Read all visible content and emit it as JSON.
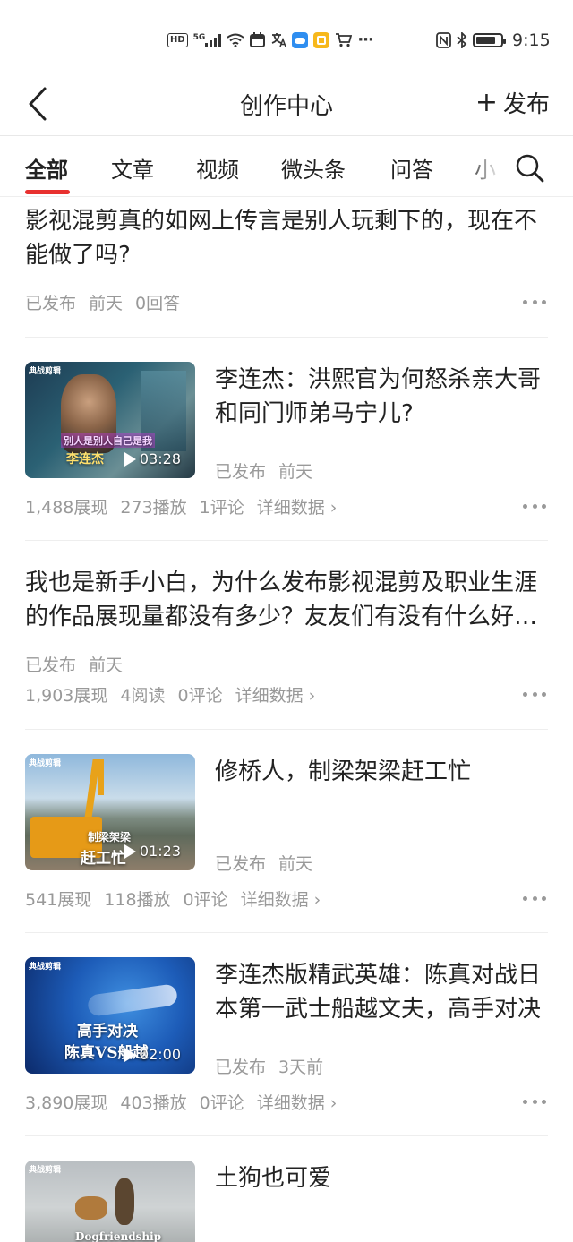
{
  "status_bar": {
    "time": "9:15",
    "left_icons": [
      "hd-icon",
      "5g-signal-icon",
      "wifi-icon",
      "calendar-icon",
      "translate-icon",
      "weather-app-icon",
      "notes-app-icon",
      "cart-icon",
      "more-notifications-icon"
    ],
    "right_icons": [
      "nfc-icon",
      "bluetooth-icon",
      "battery-icon"
    ],
    "hd_label": "HD",
    "net_label": "5G",
    "ellipsis": "···"
  },
  "header": {
    "title": "创作中心",
    "publish_label": "发布",
    "publish_plus": "+"
  },
  "tabs": [
    {
      "label": "全部",
      "active": true
    },
    {
      "label": "文章"
    },
    {
      "label": "视频"
    },
    {
      "label": "微头条"
    },
    {
      "label": "问答"
    },
    {
      "label": "小"
    }
  ],
  "colors": {
    "accent": "#e8312f",
    "meta_text": "#999999",
    "title_text": "#222222",
    "divider": "#eeeeee"
  },
  "feed": {
    "items": [
      {
        "type": "question",
        "title": "影视混剪真的如网上传言是别人玩剩下的，现在不能做了吗?",
        "meta": [
          "已发布",
          "前天",
          "0回答"
        ]
      },
      {
        "type": "video",
        "title": "李连杰：洪熙官为何怒杀亲大哥和同门师弟马宁儿?",
        "status": "已发布",
        "time": "前天",
        "duration": "03:28",
        "thumb_brand": "典战剪辑",
        "thumb_caption": "别人是别人自己是我",
        "thumb_subtitle": "李连杰",
        "stats": [
          "1,488展现",
          "273播放",
          "1评论"
        ],
        "detail_link": "详细数据 ›"
      },
      {
        "type": "article",
        "title": "我也是新手小白，为什么发布影视混剪及职业生涯的作品展现量都没有多少？友友们有没有什么好的建议",
        "meta": [
          "已发布",
          "前天"
        ],
        "stats": [
          "1,903展现",
          "4阅读",
          "0评论"
        ],
        "detail_link": "详细数据 ›"
      },
      {
        "type": "video",
        "title": "修桥人，制梁架梁赶工忙",
        "status": "已发布",
        "time": "前天",
        "duration": "01:23",
        "thumb_brand": "典战剪辑",
        "thumb_caption": "制梁架梁",
        "thumb_subtitle": "赶工忙",
        "stats": [
          "541展现",
          "118播放",
          "0评论"
        ],
        "detail_link": "详细数据 ›"
      },
      {
        "type": "video",
        "title": "李连杰版精武英雄：陈真对战日本第一武士船越文夫，高手对决",
        "status": "已发布",
        "time": "3天前",
        "duration": "02:00",
        "thumb_brand": "典战剪辑",
        "thumb_caption": "高手对决",
        "thumb_subtitle": "陈真VS船越",
        "stats": [
          "3,890展现",
          "403播放",
          "0评论"
        ],
        "detail_link": "详细数据 ›"
      },
      {
        "type": "video",
        "title": "土狗也可爱",
        "thumb_brand": "典战剪辑",
        "thumb_caption": "Dogfriendship"
      }
    ]
  }
}
